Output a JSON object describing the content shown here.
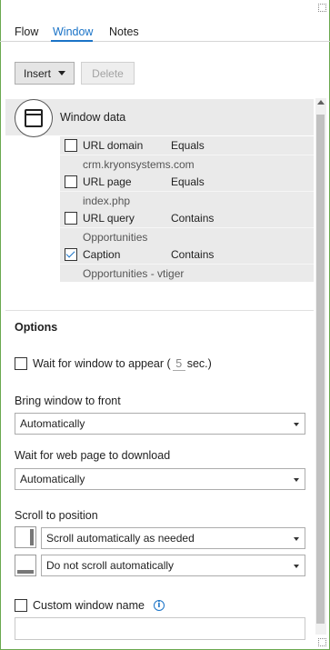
{
  "tabs": [
    {
      "label": "Flow",
      "active": false
    },
    {
      "label": "Window",
      "active": true
    },
    {
      "label": "Notes",
      "active": false
    }
  ],
  "toolbar": {
    "insert_label": "Insert",
    "delete_label": "Delete",
    "delete_enabled": false
  },
  "window_data": {
    "title": "Window data",
    "icon": "window-icon",
    "rows": [
      {
        "name": "URL domain",
        "operator": "Equals",
        "value": "crm.kryonsystems.com",
        "checked": false
      },
      {
        "name": "URL page",
        "operator": "Equals",
        "value": "index.php",
        "checked": false
      },
      {
        "name": "URL query",
        "operator": "Contains",
        "value": "Opportunities",
        "checked": false
      },
      {
        "name": "Caption",
        "operator": "Contains",
        "value": "Opportunities - vtiger",
        "checked": true
      }
    ]
  },
  "options": {
    "title": "Options",
    "wait_for_window": {
      "prefix": "Wait for window to appear (",
      "seconds": "5",
      "suffix": "sec.)",
      "checked": false
    },
    "bring_to_front": {
      "label": "Bring window to front",
      "value": "Automatically"
    },
    "wait_for_page": {
      "label": "Wait for web page to download",
      "value": "Automatically"
    },
    "scroll": {
      "label": "Scroll to position",
      "vertical_value": "Scroll automatically as needed",
      "horizontal_value": "Do not scroll automatically"
    },
    "custom_name": {
      "label": "Custom window name",
      "checked": false,
      "value": "",
      "info_icon": "info-icon"
    }
  },
  "colors": {
    "accent": "#1a73c7",
    "row_background": "#eaeaea",
    "frame": "#6aa84f"
  }
}
